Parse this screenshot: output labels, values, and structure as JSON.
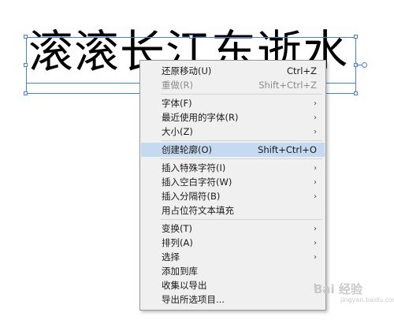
{
  "canvas": {
    "text": "滚滚长江东逝水"
  },
  "menu": {
    "items": [
      {
        "label": "还原移动(U)",
        "shortcut": "Ctrl+Z"
      },
      {
        "label": "重做(R)",
        "shortcut": "Shift+Ctrl+Z"
      },
      {
        "label": "字体(F)"
      },
      {
        "label": "最近使用的字体(R)"
      },
      {
        "label": "大小(Z)"
      },
      {
        "label": "创建轮廓(O)",
        "shortcut": "Shift+Ctrl+O"
      },
      {
        "label": "插入特殊字符(I)"
      },
      {
        "label": "插入空白字符(W)"
      },
      {
        "label": "插入分隔符(B)"
      },
      {
        "label": "用占位符文本填充"
      },
      {
        "label": "变换(T)"
      },
      {
        "label": "排列(A)"
      },
      {
        "label": "选择"
      },
      {
        "label": "添加到库"
      },
      {
        "label": "收集以导出"
      },
      {
        "label": "导出所选项目..."
      }
    ],
    "highlight_color": "#c5d9f1"
  },
  "watermark": {
    "text": "Bai 经验",
    "sub": "jingyan.baidu.com"
  }
}
